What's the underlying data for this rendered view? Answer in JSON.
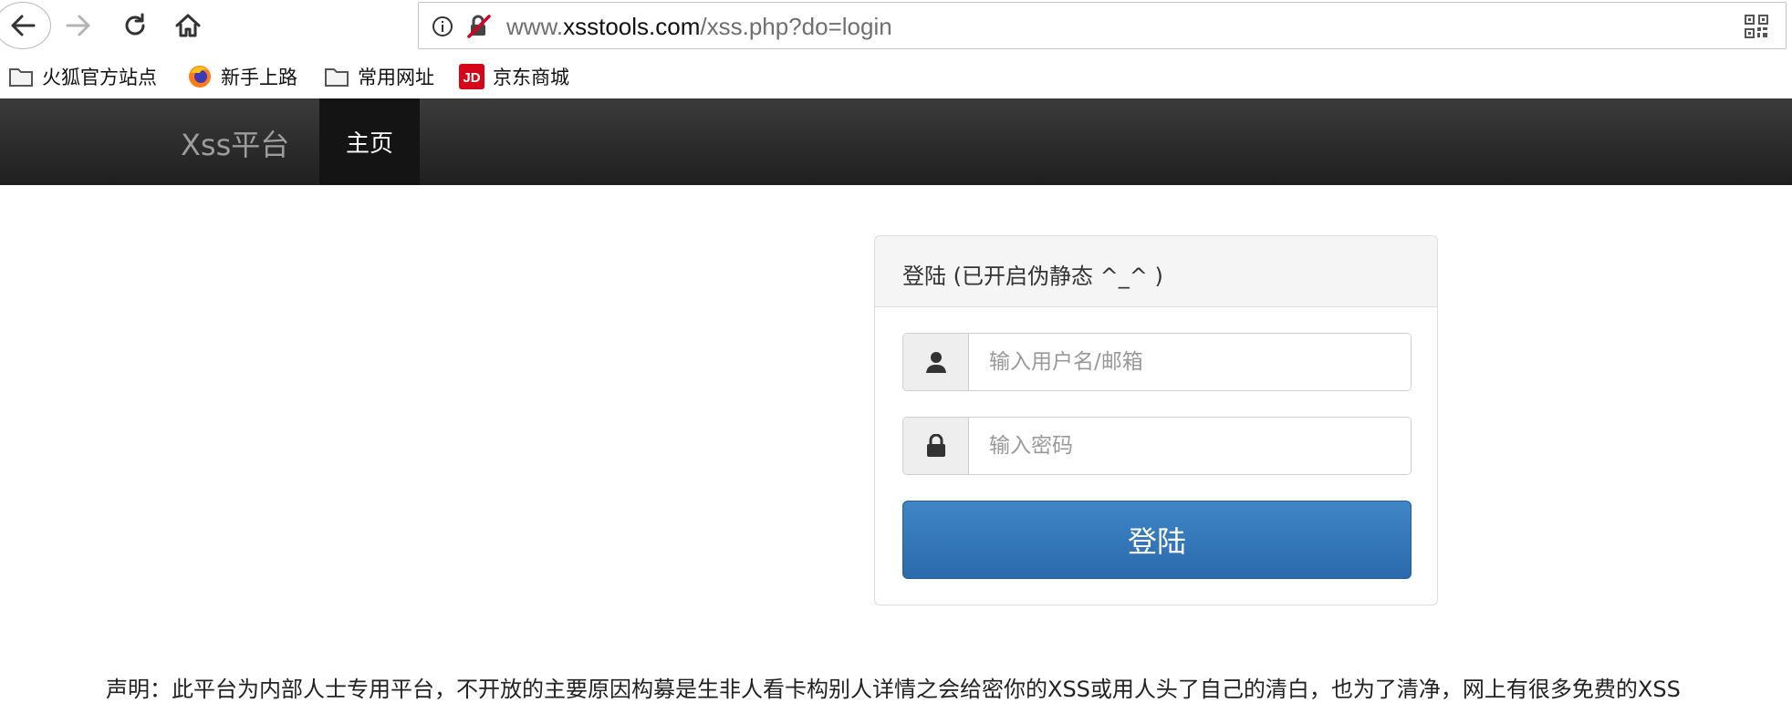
{
  "browser": {
    "url_prefix": "www.",
    "url_domain": "xsstools.com",
    "url_path": "/xss.php?do=login"
  },
  "bookmarks": [
    {
      "label": "火狐官方站点",
      "icon": "folder-icon"
    },
    {
      "label": "新手上路",
      "icon": "firefox-icon"
    },
    {
      "label": "常用网址",
      "icon": "folder-icon"
    },
    {
      "label": "京东商城",
      "icon": "jd-icon"
    }
  ],
  "jd_icon_text": "JD",
  "site": {
    "brand": "Xss平台",
    "nav_home": "主页"
  },
  "login": {
    "title": "登陆 (已开启伪静态 ^_^ )",
    "username_placeholder": "输入用户名/邮箱",
    "password_placeholder": "输入密码",
    "submit_label": "登陆"
  },
  "disclaimer": "声明：此平台为内部人士专用平台，不开放的主要原因构募是生非人看卡构别人详情之会给密你的XSS或用人头了自己的清白，也为了清净，网上有很多免费的XSS"
}
